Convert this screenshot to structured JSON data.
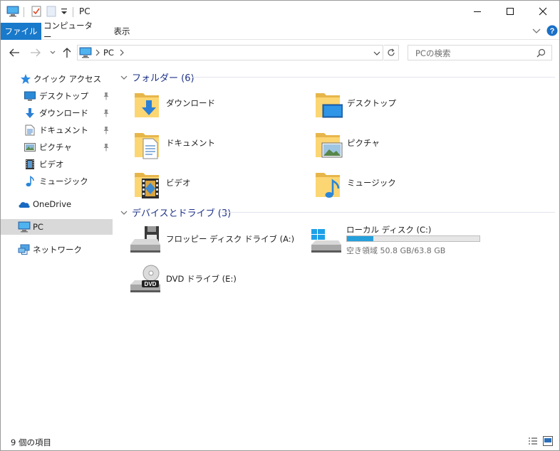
{
  "window": {
    "title": "PC"
  },
  "ribbon": {
    "tabs": [
      {
        "label": "ファイル"
      },
      {
        "label": "コンピューター"
      },
      {
        "label": "表示"
      }
    ],
    "file_color": "#1979ca"
  },
  "address": {
    "segments": [
      "PC"
    ]
  },
  "search": {
    "placeholder": "PCの検索"
  },
  "navpane": {
    "quick_access": "クイック アクセス",
    "pinned": [
      {
        "label": "デスクトップ",
        "icon": "desktop-icon",
        "pinned": true
      },
      {
        "label": "ダウンロード",
        "icon": "download-icon",
        "pinned": true
      },
      {
        "label": "ドキュメント",
        "icon": "document-icon",
        "pinned": true
      },
      {
        "label": "ピクチャ",
        "icon": "picture-icon",
        "pinned": true
      },
      {
        "label": "ビデオ",
        "icon": "video-icon",
        "pinned": false
      },
      {
        "label": "ミュージック",
        "icon": "music-icon",
        "pinned": false
      }
    ],
    "onedrive": "OneDrive",
    "pc": "PC",
    "network": "ネットワーク"
  },
  "content": {
    "folders_header": "フォルダー (6)",
    "folders": [
      {
        "label": "ダウンロード",
        "icon": "download-folder-icon"
      },
      {
        "label": "デスクトップ",
        "icon": "desktop-folder-icon"
      },
      {
        "label": "ドキュメント",
        "icon": "document-folder-icon"
      },
      {
        "label": "ピクチャ",
        "icon": "picture-folder-icon"
      },
      {
        "label": "ビデオ",
        "icon": "video-folder-icon"
      },
      {
        "label": "ミュージック",
        "icon": "music-folder-icon"
      }
    ],
    "devices_header": "デバイスとドライブ (3)",
    "devices": [
      {
        "label": "フロッピー ディスク ドライブ (A:)",
        "icon": "floppy-drive-icon"
      },
      {
        "label": "ローカル ディスク (C:)",
        "icon": "local-disk-icon",
        "free_text": "空き領域 50.8 GB/63.8 GB",
        "used_fraction": 0.2
      },
      {
        "label": "DVD ドライブ (E:)",
        "icon": "dvd-drive-icon"
      }
    ]
  },
  "status": {
    "count": "9 個の項目"
  }
}
